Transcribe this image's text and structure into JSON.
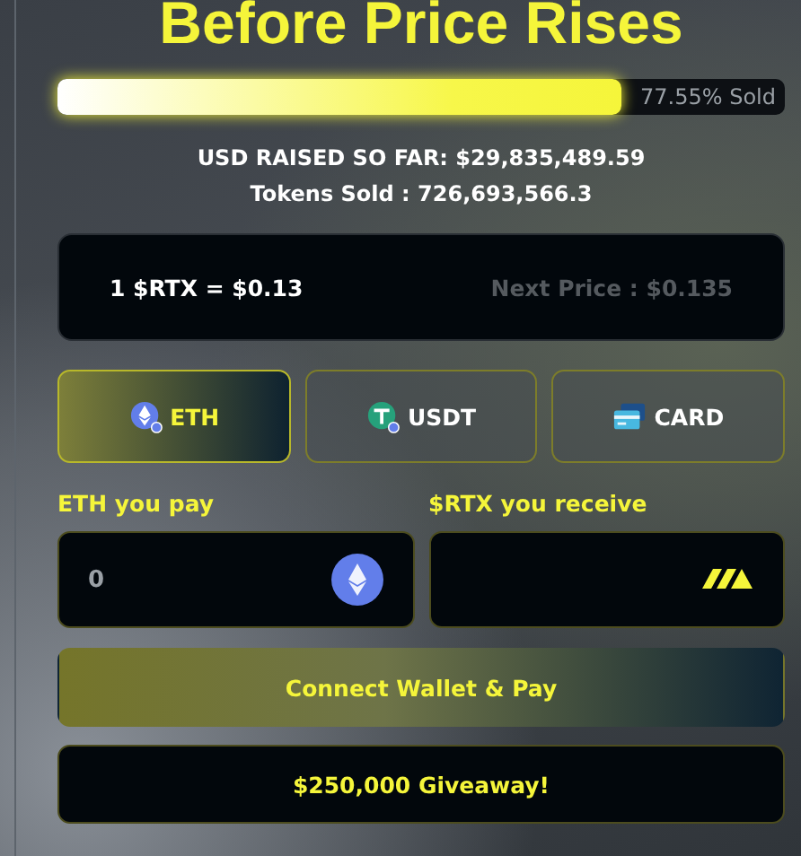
{
  "title": "Before Price Rises",
  "progress": {
    "level": 0.7755,
    "label": "77.55% Sold"
  },
  "usd_raised": "USD RAISED SO FAR: $29,835,489.59",
  "tokens_sold": "Tokens Sold : 726,693,566.3",
  "price": {
    "current": "1 $RTX = $0.13",
    "next": "Next Price : $0.135"
  },
  "tabs": [
    {
      "label": "ETH",
      "kind": "eth",
      "selected": true
    },
    {
      "label": "USDT",
      "kind": "usdt",
      "selected": false
    },
    {
      "label": "CARD",
      "kind": "card",
      "selected": false
    }
  ],
  "pay": {
    "label": "ETH you pay",
    "value": "0"
  },
  "receive": {
    "label": "$RTX you receive"
  },
  "buttons": [
    {
      "label": "Connect Wallet & Pay",
      "kind": "primary"
    },
    {
      "label": "$250,000 Giveaway!",
      "kind": "dark"
    }
  ]
}
